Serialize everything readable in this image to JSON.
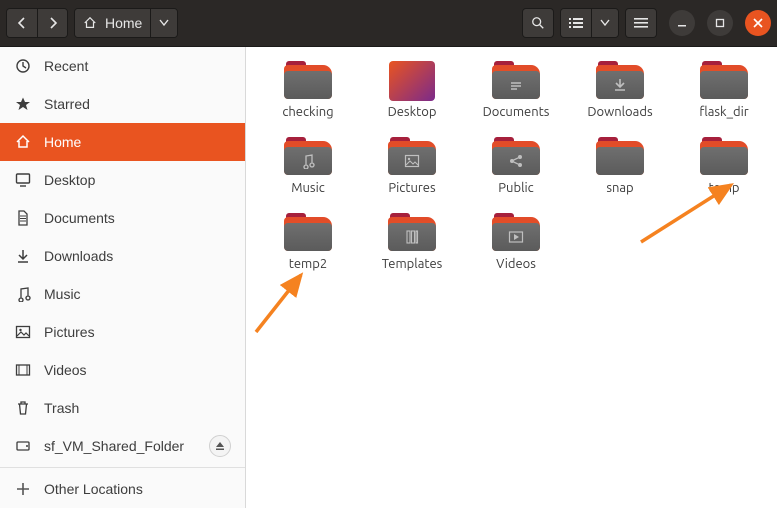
{
  "toolbar": {
    "back_label": "Back",
    "forward_label": "Forward",
    "location_label": "Home",
    "search_tooltip": "Search",
    "view_tooltip": "List view",
    "menu_tooltip": "Menu"
  },
  "window": {
    "minimize_label": "Minimize",
    "maximize_label": "Maximize",
    "close_label": "Close"
  },
  "sidebar": {
    "items": [
      {
        "id": "recent",
        "label": "Recent",
        "icon": "clock-icon",
        "active": false
      },
      {
        "id": "starred",
        "label": "Starred",
        "icon": "star-icon",
        "active": false
      },
      {
        "id": "home",
        "label": "Home",
        "icon": "home-icon",
        "active": true
      },
      {
        "id": "desktop",
        "label": "Desktop",
        "icon": "desktop-icon",
        "active": false
      },
      {
        "id": "documents",
        "label": "Documents",
        "icon": "document-icon",
        "active": false
      },
      {
        "id": "downloads",
        "label": "Downloads",
        "icon": "download-icon",
        "active": false
      },
      {
        "id": "music",
        "label": "Music",
        "icon": "music-icon",
        "active": false
      },
      {
        "id": "pictures",
        "label": "Pictures",
        "icon": "picture-icon",
        "active": false
      },
      {
        "id": "videos",
        "label": "Videos",
        "icon": "video-icon",
        "active": false
      },
      {
        "id": "trash",
        "label": "Trash",
        "icon": "trash-icon",
        "active": false
      }
    ],
    "mounts": [
      {
        "id": "sf_vm",
        "label": "sf_VM_Shared_Folder",
        "icon": "disk-icon",
        "ejectable": true
      }
    ],
    "other_locations_label": "Other Locations"
  },
  "content": {
    "folders": [
      {
        "label": "checking",
        "glyph": ""
      },
      {
        "label": "Desktop",
        "type": "desktop"
      },
      {
        "label": "Documents",
        "glyph": "document"
      },
      {
        "label": "Downloads",
        "glyph": "download"
      },
      {
        "label": "flask_dir",
        "glyph": ""
      },
      {
        "label": "Music",
        "glyph": "music"
      },
      {
        "label": "Pictures",
        "glyph": "picture"
      },
      {
        "label": "Public",
        "glyph": "share"
      },
      {
        "label": "snap",
        "glyph": ""
      },
      {
        "label": "temp",
        "glyph": ""
      },
      {
        "label": "temp2",
        "glyph": ""
      },
      {
        "label": "Templates",
        "glyph": "template"
      },
      {
        "label": "Videos",
        "glyph": "video"
      }
    ]
  },
  "annotations": {
    "arrow_color": "#f58220",
    "targets": [
      "temp",
      "temp2"
    ]
  }
}
